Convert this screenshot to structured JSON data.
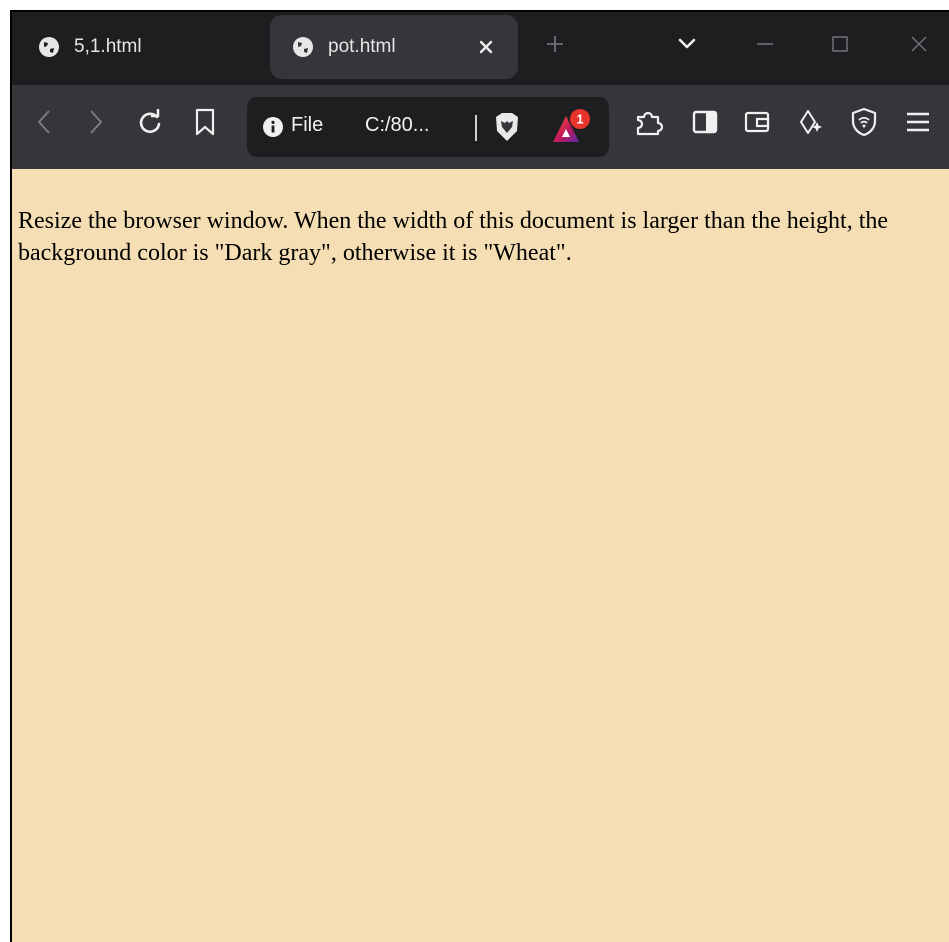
{
  "tabs": [
    {
      "title": "5,1.html",
      "active": false
    },
    {
      "title": "pot.html",
      "active": true
    }
  ],
  "address_bar": {
    "scheme_label": "File",
    "path": "C:/80..."
  },
  "rewards_badge": "1",
  "page": {
    "background_color": "#f5deb3",
    "text": "Resize the browser window. When the width of this document is larger than the height, the background color is \"Dark gray\", otherwise it is \"Wheat\"."
  },
  "icons": {
    "tab_favicon": "globe-icon",
    "tab_close": "close-icon",
    "new_tab": "plus-icon",
    "tab_search": "chevron-down-icon",
    "minimize": "minimize-icon",
    "maximize": "maximize-icon",
    "window_close": "close-icon",
    "back": "arrow-left-icon",
    "forward": "arrow-right-icon",
    "reload": "reload-icon",
    "bookmark": "bookmark-icon",
    "site_info": "info-icon",
    "brave_shields": "lion-shield-icon",
    "brave_rewards": "triangle-rewards-icon",
    "extensions": "puzzle-icon",
    "sidebar": "sidebar-icon",
    "wallet": "wallet-icon",
    "leo_ai": "sparkle-icon",
    "vpn": "vpn-shield-icon",
    "menu": "hamburger-menu-icon"
  },
  "colors": {
    "tab_strip": "#1e1e21",
    "toolbar": "#35353a",
    "rewards_badge": "#e8342a"
  }
}
